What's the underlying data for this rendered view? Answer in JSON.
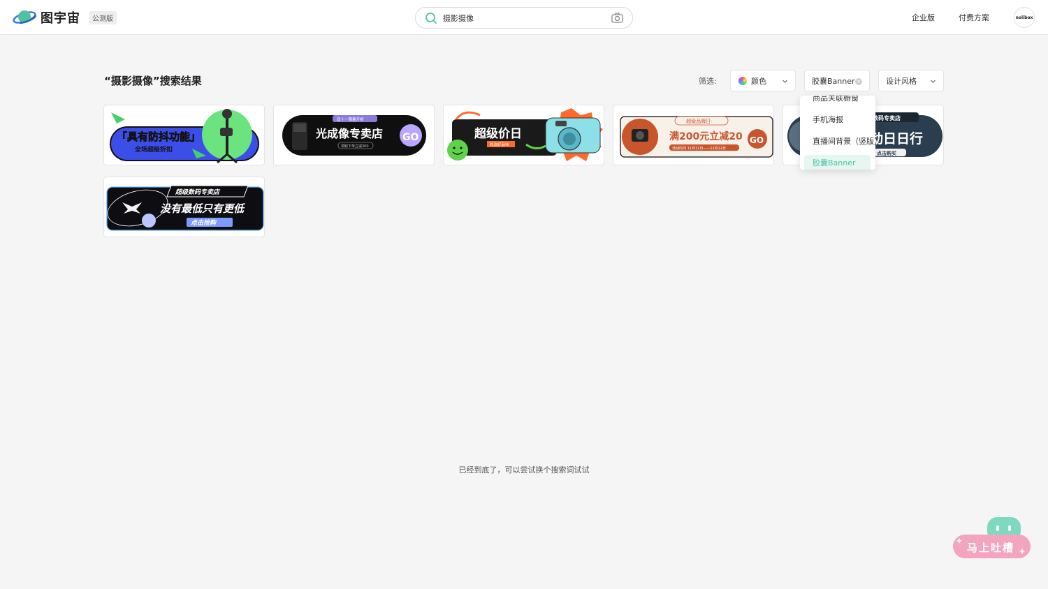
{
  "header": {
    "logo_text": "图宇宙",
    "beta_badge": "公测版",
    "search_value": "摄影摄像",
    "nav": {
      "enterprise": "企业版",
      "pricing": "付费方案"
    },
    "avatar_text": "nolibox"
  },
  "results": {
    "title": "“摄影摄像”搜索结果",
    "filter_label": "筛选:",
    "filters": {
      "color": "颜色",
      "type": "胶囊Banner",
      "style": "设计风格"
    }
  },
  "dropdown": {
    "items": [
      "商品关联橱窗",
      "手机海报",
      "直播间背景（竖版）",
      "胶囊Banner"
    ]
  },
  "cards": [
    {
      "main": "「具有防抖功能」",
      "sub": "全场超级折扣"
    },
    {
      "main": "光成像专卖店",
      "tag": "双十一限量开抢",
      "sub": "领取下单立减300",
      "go": "GO"
    },
    {
      "main": "超级价日",
      "sub": "甄选好品味"
    },
    {
      "main": "满200元立减20",
      "tag": "·超级品牌日·",
      "sub": "活动时间 11月11日——11月12日",
      "go": "GO"
    },
    {
      "main": "动日日行",
      "tag": "数码专卖店",
      "sub": "点击购买"
    },
    {
      "main": "没有最低只有更低",
      "tag": "超级数码专卖店",
      "sub": "点击抢购"
    }
  ],
  "bottom_note": "已经到底了，可以尝试换个搜索词试试",
  "feedback_label": "马上吐槽",
  "colors": {
    "accent": "#4fc3a1",
    "feedback": "#f3a4bf"
  }
}
